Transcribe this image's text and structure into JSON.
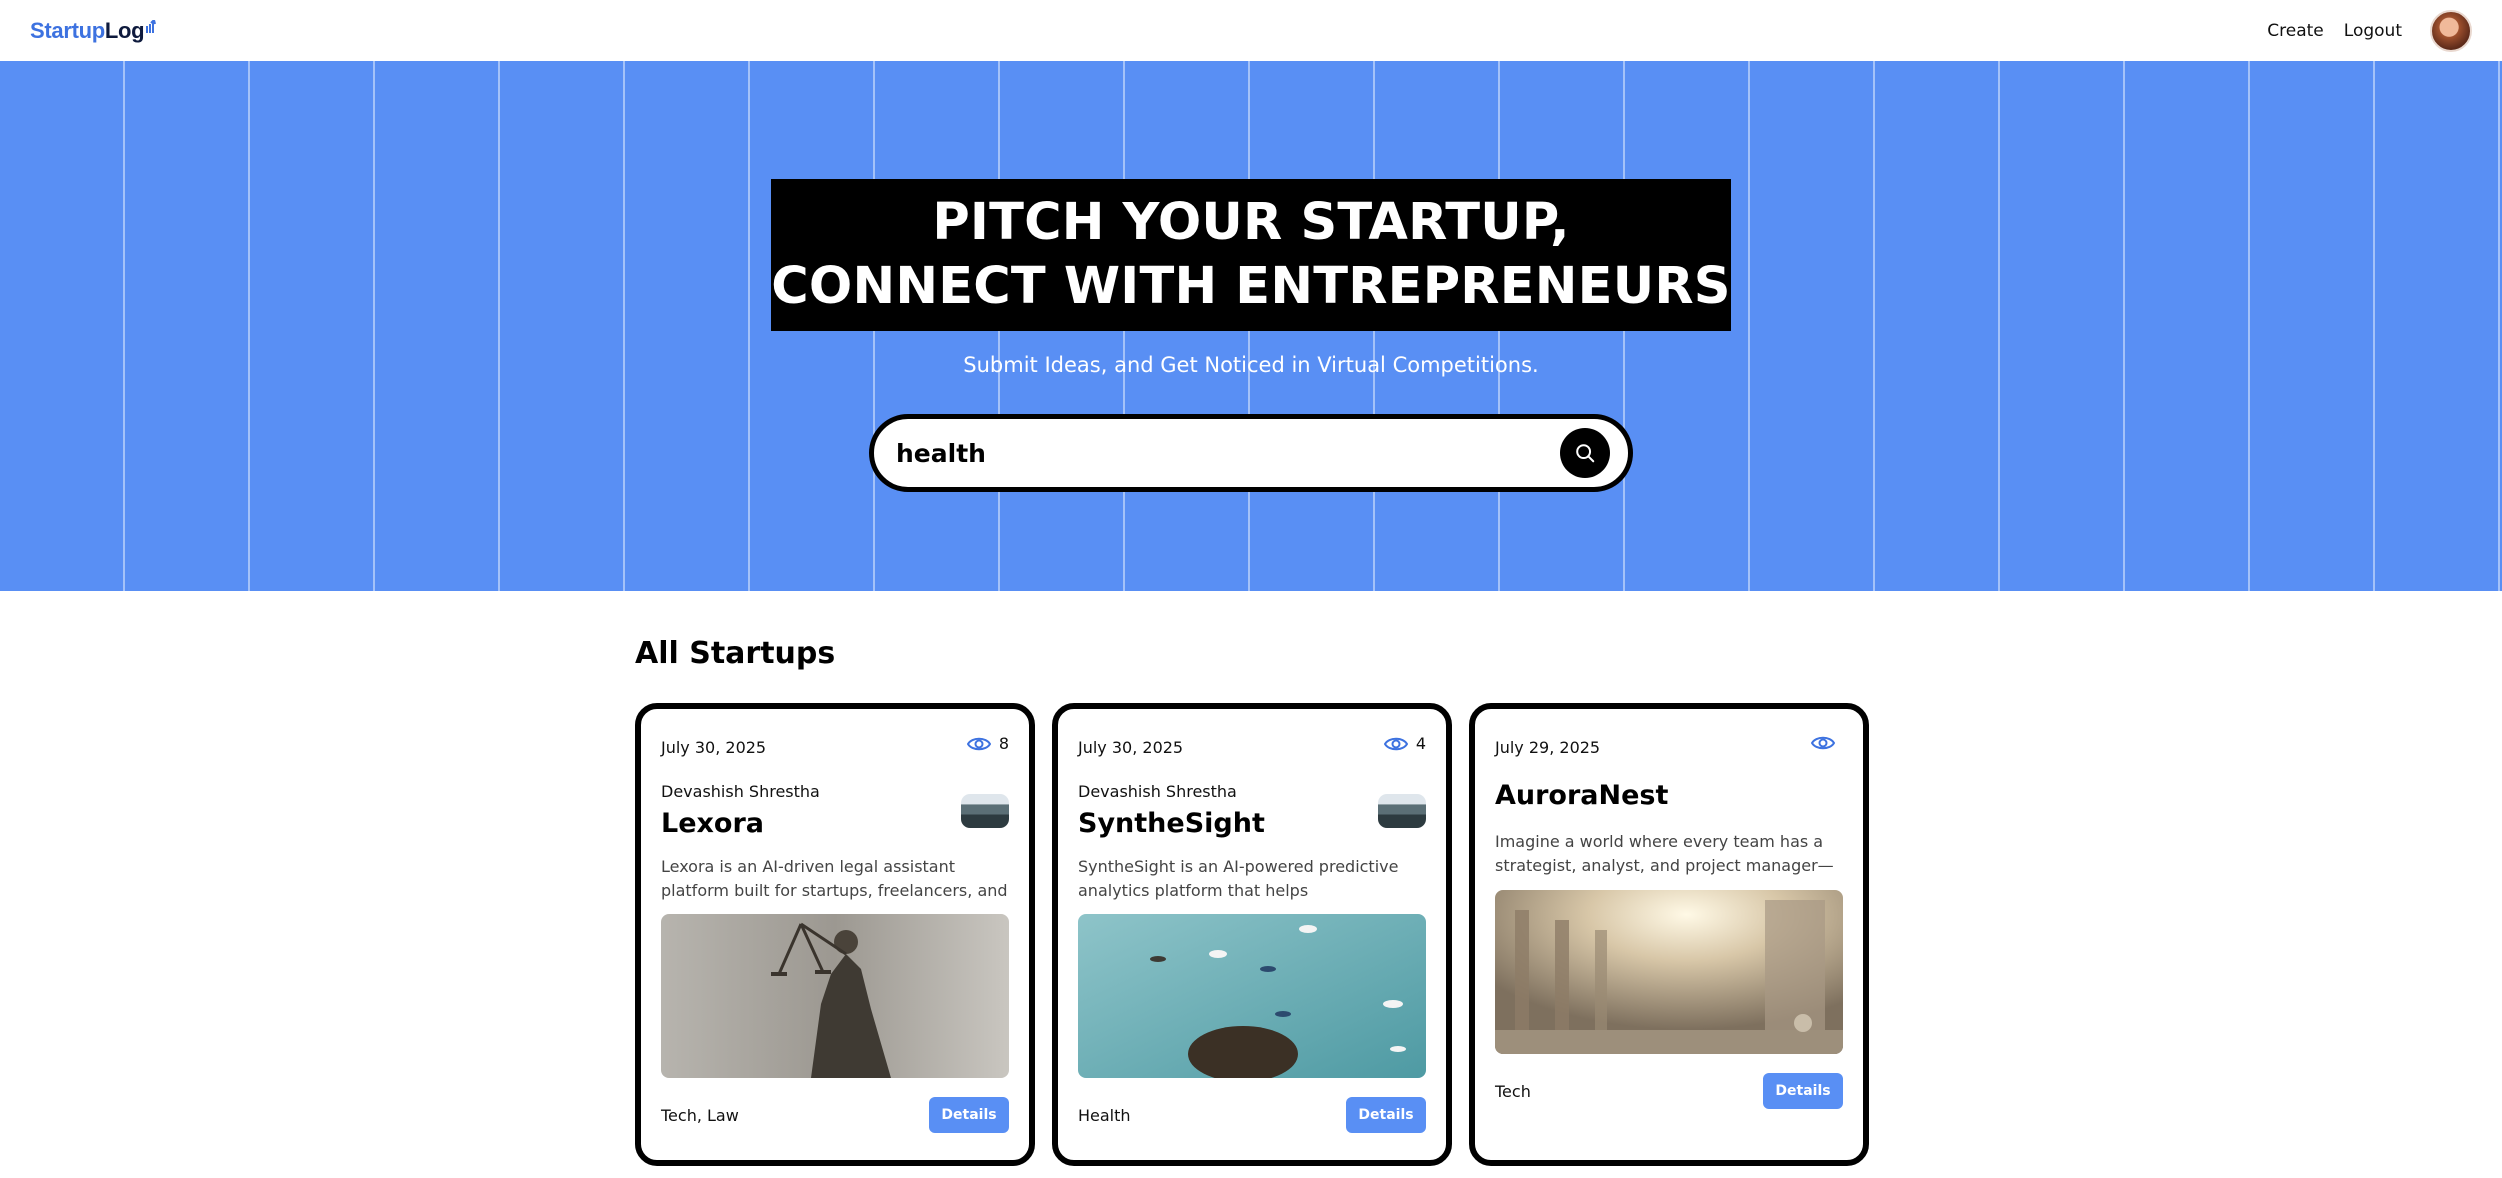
{
  "navbar": {
    "logo_part1": "Startup",
    "logo_part2": "Log",
    "create_label": "Create",
    "logout_label": "Logout"
  },
  "hero": {
    "headline_line1": "PITCH YOUR STARTUP,",
    "headline_line2": "CONNECT WITH ENTREPRENEURS",
    "subheading": "Submit Ideas, and Get Noticed in Virtual Competitions.",
    "search_value": "health"
  },
  "section": {
    "title": "All Startups"
  },
  "cards": [
    {
      "date": "July 30, 2025",
      "views": "8",
      "author": "Devashish Shrestha",
      "title": "Lexora",
      "description": "Lexora is an AI-driven legal assistant platform built for startups, freelancers, and smal...",
      "category": "Tech, Law",
      "button_label": "Details",
      "image_icon": "lady-justice-statue-image"
    },
    {
      "date": "July 30, 2025",
      "views": "4",
      "author": "Devashish Shrestha",
      "title": "SyntheSight",
      "description": "SyntheSight is an AI-powered predictive analytics platform that helps manufacturers...",
      "category": "Health",
      "button_label": "Details",
      "image_icon": "boats-aerial-ocean-image"
    },
    {
      "date": "July 29, 2025",
      "views": "",
      "author": "",
      "title": "AuroraNest",
      "description": "Imagine a world where every team has a strategist, analyst, and project manager—wit...",
      "category": "Tech",
      "button_label": "Details",
      "image_icon": "sunlit-city-street-image"
    }
  ],
  "colors": {
    "accent": "#598ff4",
    "logo_blue": "#3d72e0",
    "logo_navy": "#0e1a3d",
    "headline_bg": "#000000"
  }
}
